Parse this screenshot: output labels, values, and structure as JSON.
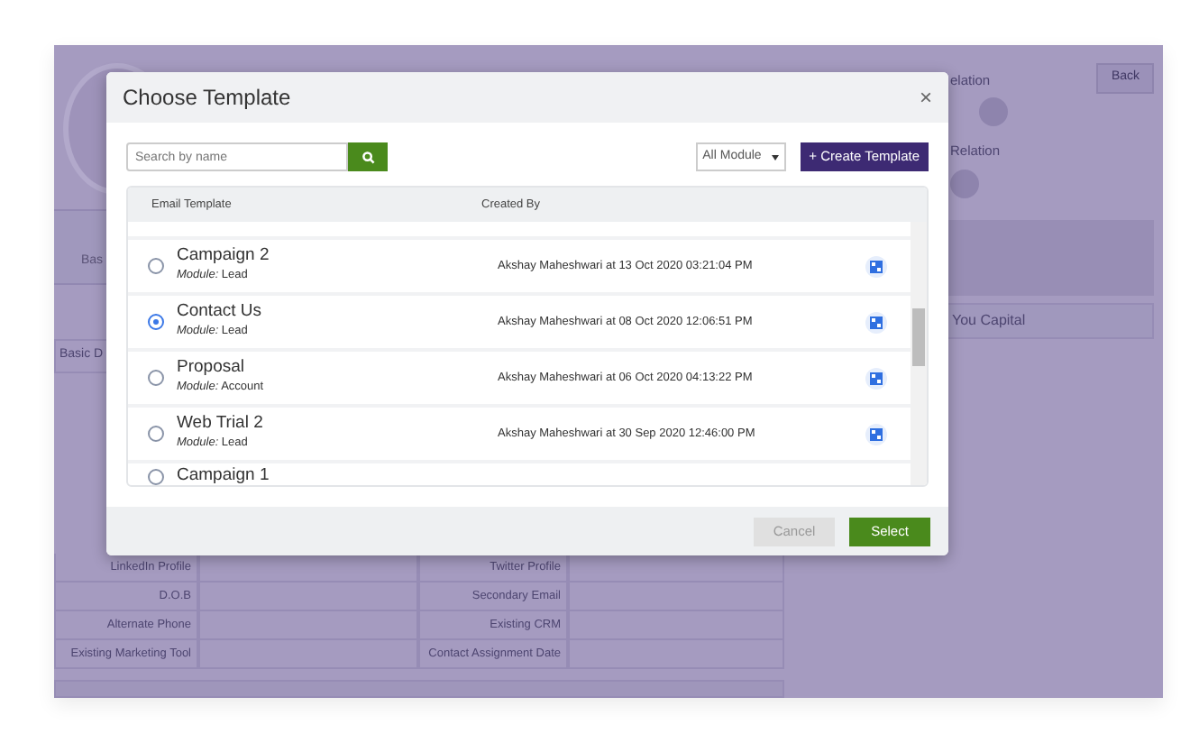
{
  "background": {
    "back_button": "Back",
    "relations": [
      "elation",
      "Relation"
    ],
    "tab_label": "Bas",
    "section_title": "Basic D",
    "company": "You Capital",
    "fields": [
      [
        "LinkedIn Profile",
        "Twitter Profile"
      ],
      [
        "D.O.B",
        "Secondary Email"
      ],
      [
        "Alternate Phone",
        "Existing CRM"
      ],
      [
        "Existing Marketing Tool",
        "Contact Assignment Date"
      ]
    ]
  },
  "modal": {
    "title": "Choose Template",
    "close": "×",
    "search": {
      "placeholder": "Search by name"
    },
    "module_filter": "All Module",
    "create_button": "+ Create Template",
    "columns": [
      "Email Template",
      "Created By"
    ],
    "rows": [
      {
        "name": "Campaign 2",
        "module": "*Module:* Lead",
        "created_by": "Akshay Maheshwari at 13 Oct 2020 03:21:04 PM",
        "selected": false
      },
      {
        "name": "Contact Us",
        "module": "*Module:* Lead",
        "created_by": "Akshay Maheshwari at 08 Oct 2020 12:06:51 PM",
        "selected": true
      },
      {
        "name": "Proposal",
        "module": "*Module:* Account",
        "created_by": "Akshay Maheshwari at 06 Oct 2020 04:13:22 PM",
        "selected": false
      },
      {
        "name": "Web Trial 2",
        "module": "*Module:* Lead",
        "created_by": "Akshay Maheshwari at 30 Sep 2020 12:46:00 PM",
        "selected": false
      },
      {
        "name": "Campaign 1",
        "selected": false
      }
    ],
    "buttons": [
      {
        "label": "Cancel",
        "disabled": true
      },
      {
        "label": "Select",
        "disabled": false
      }
    ]
  }
}
